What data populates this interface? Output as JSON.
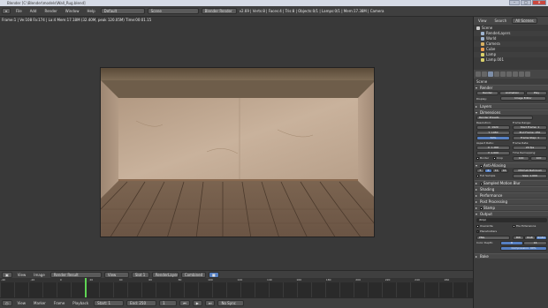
{
  "window": {
    "title": "Blender [C:\\Blender\\models\\Wall_Rug.blend]",
    "controls": [
      "–",
      "□",
      "✕"
    ]
  },
  "info_header": {
    "menus": [
      "File",
      "Add",
      "Render",
      "Window",
      "Help"
    ],
    "layout": "Default",
    "scene": "Scene",
    "engine": "Blender Render",
    "stats": "v2.69 | Verts:8 | Faces:4 | Tris:8 | Objects:0/1 | Lamps:0/1 | Mem:17.38M | Camera"
  },
  "viewport": {
    "render_info": "Frame:1 | Ve:108 Fa:174 | La:4 Mem:17.18M (32.40M, peak 120.05M) Time:00:01.15"
  },
  "image_editor_header": {
    "menus": [
      "View",
      "Image"
    ],
    "image": "Render Result",
    "view": "View",
    "slot": "Slot 1",
    "layer": "RenderLayer",
    "pass": "Combined"
  },
  "timeline": {
    "ruler_ticks": [
      "-40",
      "-20",
      "0",
      "20",
      "40",
      "60",
      "80",
      "100",
      "120",
      "140",
      "160",
      "180",
      "200",
      "220",
      "240",
      "260"
    ],
    "menus": [
      "View",
      "Marker",
      "Frame",
      "Playback"
    ],
    "start": "Start: 1",
    "end": "End: 250",
    "current": "1",
    "sync": "No Sync"
  },
  "outliner": {
    "menus": [
      "View",
      "Search",
      "All Scenes"
    ],
    "rows": [
      {
        "label": "Scene",
        "color": "#c8c8c8"
      },
      {
        "label": "RenderLayers",
        "color": "#9fb4d0"
      },
      {
        "label": "World",
        "color": "#9fb4d0"
      },
      {
        "label": "Camera",
        "color": "#d9b061"
      },
      {
        "label": "Cube",
        "color": "#f0a050"
      },
      {
        "label": "Lamp",
        "color": "#d9d06a"
      },
      {
        "label": "Lamp.001",
        "color": "#d9d06a"
      }
    ]
  },
  "properties": {
    "context": "Scene",
    "render_panel": "Render",
    "render_buttons": [
      "Render",
      "Animation",
      "Play"
    ],
    "display_label": "Display:",
    "display_value": "Image Editor",
    "layers": "Layers",
    "dimensions": "Dimensions",
    "presets": "Render Presets",
    "resolution": "Resolution:",
    "frame_range": "Frame Range:",
    "res_x": "X: 1920",
    "res_y": "Y: 1080",
    "res_pct": "50%",
    "start_frame": "Start Frame: 1",
    "end_frame": "End Frame: 250",
    "frame_step": "Frame Step: 1",
    "aspect": "Aspect Ratio:",
    "frame_rate": "Frame Rate:",
    "asp_x": "X: 1.000",
    "asp_y": "Y: 1.000",
    "fps": "24 fps",
    "time_remap": "Time Remapping:",
    "border": "Border",
    "crop": "Crop",
    "remap_old": "100",
    "remap_new": "100",
    "antialiasing": "Anti-Aliasing",
    "aa_samples": [
      "5",
      "8",
      "11",
      "16"
    ],
    "aa_filter": "Mitchell-Netravali",
    "full_sample": "Full Sample",
    "aa_size": "Size: 1.000",
    "panels": [
      "Sampled Motion Blur",
      "Shading",
      "Performance",
      "Post Processing",
      "Stamp",
      "Output"
    ],
    "output_path": "/tmp\\",
    "overwrite": "Overwrite",
    "file_ext": "File Extensions",
    "placeholders": "Placeholders",
    "format": "PNG",
    "color_modes": [
      "BW",
      "RGB",
      "RGBA"
    ],
    "color_depth": "Color Depth:",
    "depth_8": "8",
    "depth_16": "16",
    "compression": "Compression: 90%",
    "bake": "Bake"
  }
}
